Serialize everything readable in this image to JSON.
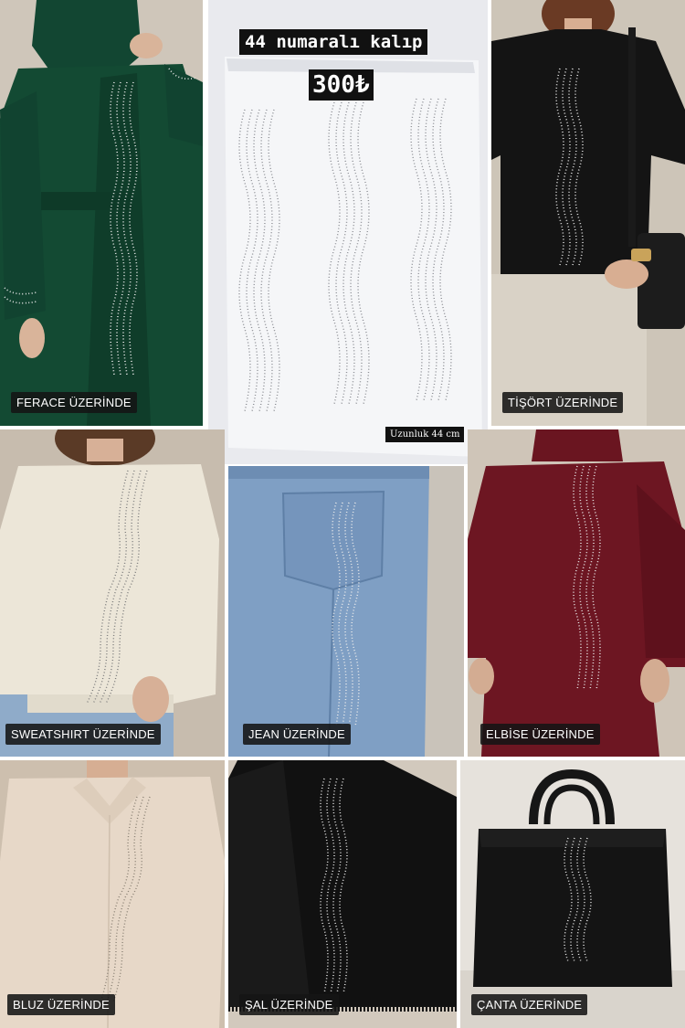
{
  "header": {
    "title": "44 numaralı kalıp",
    "price": "300₺",
    "length_note": "Uzunluk 44 cm"
  },
  "tiles": {
    "ferace": {
      "label": "FERACE ÜZERİNDE",
      "garment_color": "#134a33"
    },
    "tisort": {
      "label": "TİŞÖRT ÜZERİNDE",
      "garment_color": "#141414"
    },
    "sweatshirt": {
      "label": "SWEATSHIRT ÜZERİNDE",
      "garment_color": "#ece6d8"
    },
    "jean": {
      "label": "JEAN ÜZERİNDE",
      "garment_color": "#7f9fc4"
    },
    "elbise": {
      "label": "ELBİSE ÜZERİNDE",
      "garment_color": "#6d1622"
    },
    "bluz": {
      "label": "BLUZ ÜZERİNDE",
      "garment_color": "#e7d8c8"
    },
    "sal": {
      "label": "ŞAL ÜZERİNDE",
      "garment_color": "#111111"
    },
    "canta": {
      "label": "ÇANTA ÜZERİNDE",
      "garment_color": "#141414"
    }
  }
}
